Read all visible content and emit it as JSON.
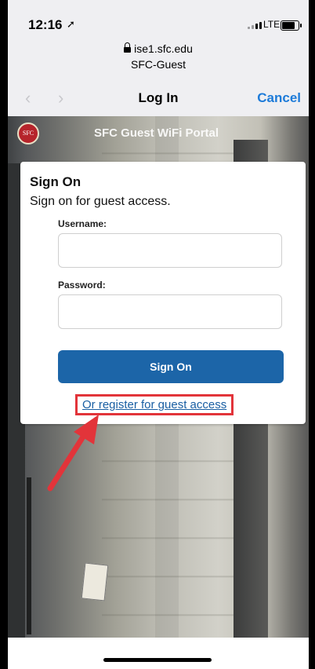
{
  "status_bar": {
    "time": "12:16",
    "carrier_type": "LTE"
  },
  "address": {
    "domain": "ise1.sfc.edu",
    "network": "SFC-Guest"
  },
  "nav": {
    "title": "Log In",
    "cancel_label": "Cancel"
  },
  "portal": {
    "title": "SFC Guest WiFi Portal",
    "seal_text": "SFC"
  },
  "card": {
    "title": "Sign On",
    "subtitle": "Sign on for guest access.",
    "username_label": "Username:",
    "password_label": "Password:",
    "username_value": "",
    "password_value": "",
    "signin_button": "Sign On",
    "register_link": "Or register for guest access"
  },
  "colors": {
    "accent": "#1c65a8",
    "highlight": "#e2343a",
    "link": "#1a5fa3"
  }
}
